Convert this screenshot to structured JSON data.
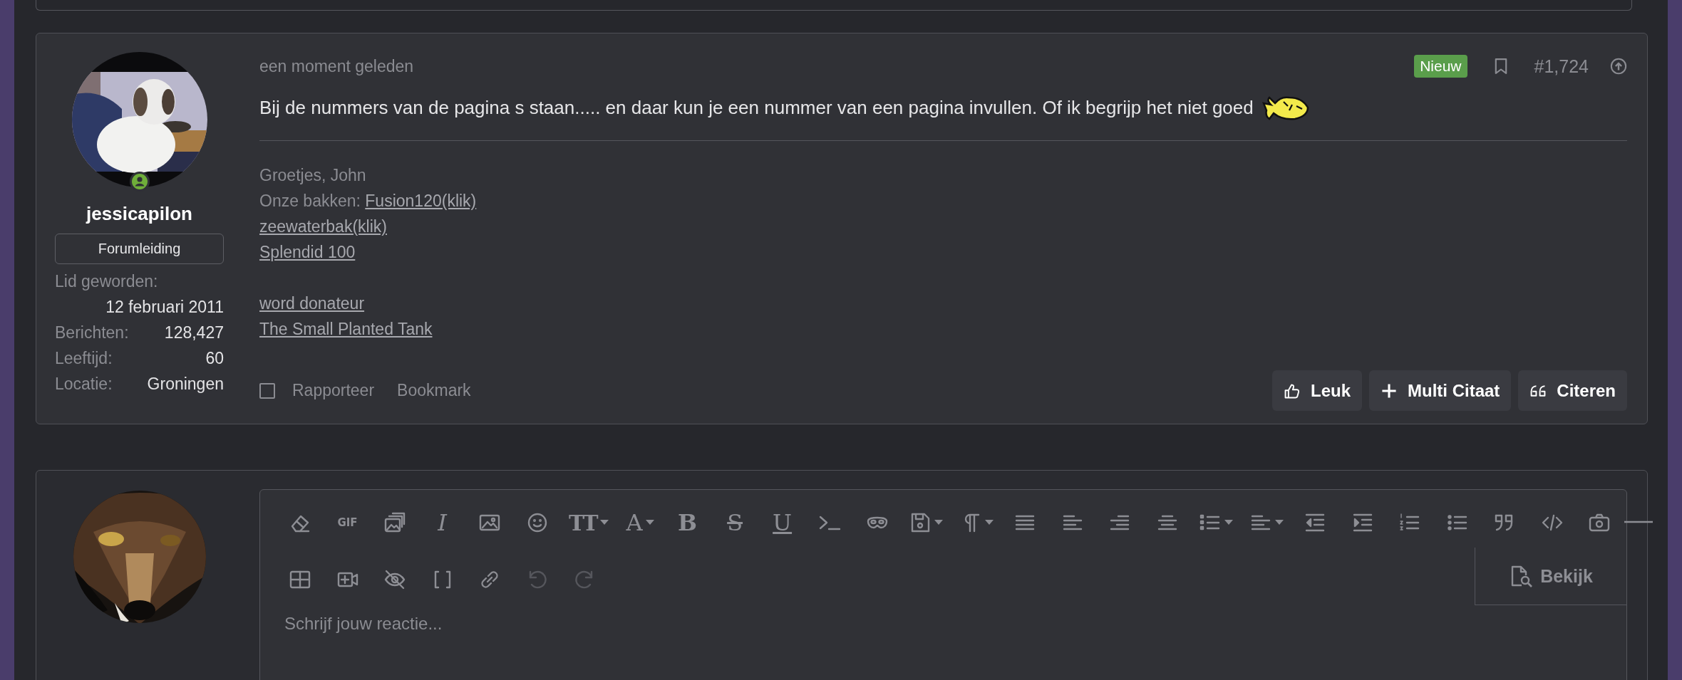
{
  "post": {
    "online": true,
    "username": "jessicapilon",
    "role": "Forumleiding",
    "stats": [
      {
        "kind": "stacked",
        "label": "Lid geworden:",
        "value": "12 februari 2011"
      },
      {
        "kind": "inline",
        "label": "Berichten:",
        "value": "128,427"
      },
      {
        "kind": "inline",
        "label": "Leeftijd:",
        "value": "60"
      },
      {
        "kind": "inline",
        "label": "Locatie:",
        "value": "Groningen"
      }
    ],
    "time": "een moment geleden",
    "badge": "Nieuw",
    "bookmarked": false,
    "number": "#1,724",
    "message": "Bij de nummers van de pagina s staan..... en daar kun je een nummer van een pagina invullen. Of ik begrijp het niet goed",
    "signature": [
      {
        "kind": "text",
        "text": "Groetjes, John"
      },
      {
        "kind": "text",
        "text": "Onze bakken:",
        "link": "Fusion120(klik)"
      },
      {
        "kind": "link",
        "link": "zeewaterbak(klik)"
      },
      {
        "kind": "link",
        "link": "Splendid 100"
      },
      {
        "kind": "blank"
      },
      {
        "kind": "link",
        "link": "word donateur"
      },
      {
        "kind": "link",
        "link": "The Small Planted Tank"
      }
    ],
    "report": {
      "label": "Rapporteer",
      "checked": false
    },
    "bookmark_link": "Bookmark",
    "buttons": [
      {
        "kind": "like",
        "label": "Leuk"
      },
      {
        "kind": "multiquote",
        "label": "Multi Citaat"
      },
      {
        "kind": "quote",
        "label": "Citeren"
      }
    ]
  },
  "reply": {
    "glyphs": [
      "GIF",
      "I",
      "TT",
      "A",
      "B",
      "S",
      "U"
    ],
    "undo": {
      "disabled": true
    },
    "redo": {
      "disabled": true
    },
    "preview": "Bekijk",
    "placeholder": "Schrijf jouw reactie..."
  }
}
